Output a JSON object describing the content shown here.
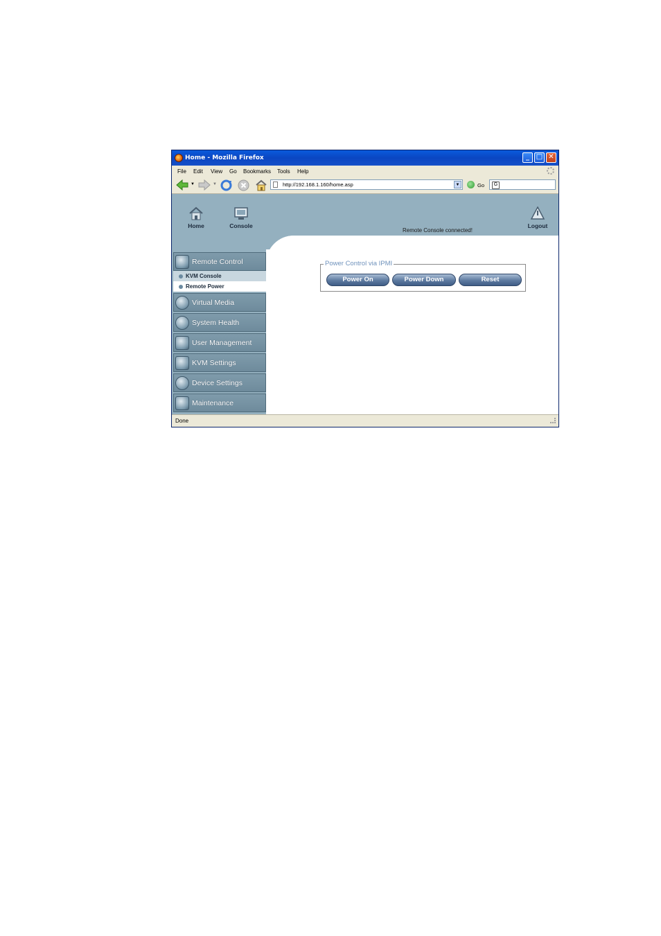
{
  "window": {
    "title": "Home - Mozilla Firefox"
  },
  "menubar": {
    "items": [
      "File",
      "Edit",
      "View",
      "Go",
      "Bookmarks",
      "Tools",
      "Help"
    ]
  },
  "navbar": {
    "url": "http://192.168.1.160/home.asp",
    "go_label": "Go",
    "search_value": ""
  },
  "header": {
    "home_label": "Home",
    "console_label": "Console",
    "logout_label": "Logout",
    "status": "Remote Console connected!"
  },
  "sidebar": {
    "sections": [
      {
        "label": "Remote Control",
        "sub_items": [
          "KVM Console",
          "Remote Power"
        ],
        "selected": "Remote Power"
      },
      {
        "label": "Virtual Media"
      },
      {
        "label": "System Health"
      },
      {
        "label": "User Management"
      },
      {
        "label": "KVM Settings"
      },
      {
        "label": "Device Settings"
      },
      {
        "label": "Maintenance"
      }
    ]
  },
  "power_control": {
    "legend": "Power Control via IPMI",
    "buttons": [
      "Power On",
      "Power Down",
      "Reset"
    ]
  },
  "statusbar": {
    "text": "Done"
  },
  "colors": {
    "band": "#94b0bf",
    "menu_head": "#7f9bab",
    "title_bar": "#0a46c2",
    "legend": "#6f92bc"
  }
}
